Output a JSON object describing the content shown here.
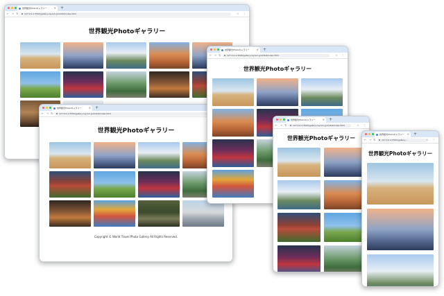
{
  "page_title": "世界観光Photoギャラリー",
  "tab_title": "世界観光Photoギャラリー",
  "url": "127.0.0.1:5500/gallery-layout-grid/dist/index.html",
  "url_short": "127.0.0.1:5500/gallery...",
  "footer": "Copyright © World Travel Photo Gallery All Rights Reserved.",
  "nav_glyphs": "← → ↻",
  "tab_close": "×",
  "new_tab": "+",
  "toolbar_glyphs": "☆ ⋮",
  "photos": [
    "pyramids",
    "eiffel-tower",
    "taj-mahal",
    "florence",
    "windmill",
    "times-square",
    "machu-picchu",
    "kyoto-street",
    "volcano-field",
    "gothic-spire",
    "colorful-town",
    "jungle",
    "temple-spires"
  ]
}
